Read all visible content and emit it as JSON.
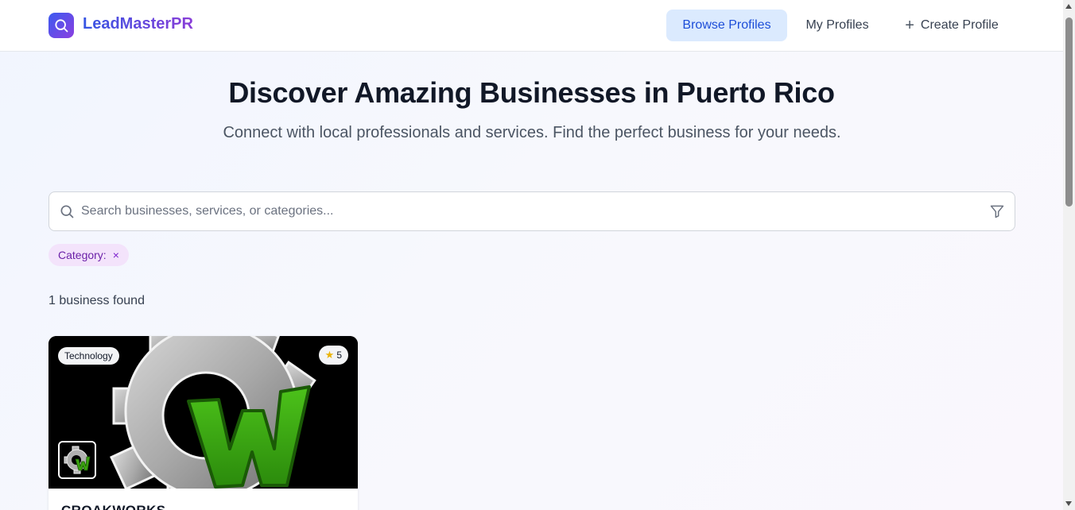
{
  "brand": {
    "name": "LeadMasterPR"
  },
  "nav": {
    "browse_label": "Browse Profiles",
    "my_label": "My Profiles",
    "create_label": "Create Profile"
  },
  "hero": {
    "title": "Discover Amazing Businesses in Puerto Rico",
    "subtitle": "Connect with local professionals and services. Find the perfect business for your needs."
  },
  "search": {
    "placeholder": "Search businesses, services, or categories...",
    "value": ""
  },
  "filters": {
    "active_chip_label": "Category:",
    "remove_symbol": "×"
  },
  "results": {
    "count_text": "1 business found",
    "cards": [
      {
        "category": "Technology",
        "rating": "5",
        "title": "CROAKWORKS"
      }
    ]
  },
  "colors": {
    "accent": "#1d4ed8",
    "nav_active_bg": "#dbeafe",
    "brand_from": "#3b5bf0",
    "brand_to": "#8b3fe0",
    "chip_bg": "#f3e3fb",
    "chip_text": "#6b21a8",
    "logo_green": "#3aa10f"
  },
  "icons": {
    "logo": "search-icon",
    "create": "plus-icon",
    "search": "search-icon",
    "filter": "filter-icon",
    "rating": "star-icon",
    "remove": "close-icon"
  }
}
